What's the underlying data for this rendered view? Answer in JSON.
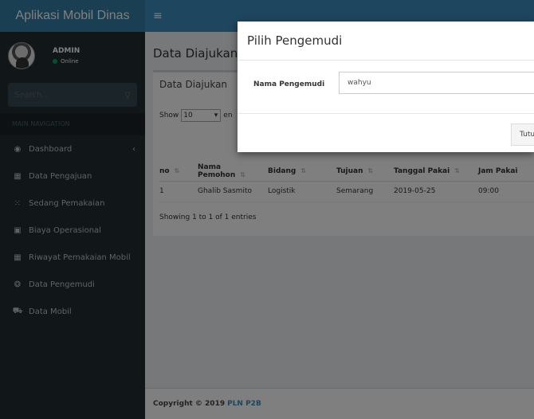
{
  "app": {
    "title": "Aplikasi Mobil Dinas"
  },
  "user": {
    "name": "ADMIN",
    "status": "Online"
  },
  "search": {
    "placeholder": "Search..."
  },
  "nav": {
    "header": "MAIN NAVIGATION",
    "items": [
      {
        "label": "Dashboard",
        "icon": "dashboard-icon"
      },
      {
        "label": "Data Pengajuan",
        "icon": "table-icon"
      },
      {
        "label": "Sedang Pemakaian",
        "icon": "spinner-icon"
      },
      {
        "label": "Biaya Operasional",
        "icon": "money-icon"
      },
      {
        "label": "Riwayat Pemakaian Mobil",
        "icon": "calendar-icon"
      },
      {
        "label": "Data Pengemudi",
        "icon": "steering-icon"
      },
      {
        "label": "Data Mobil",
        "icon": "car-icon"
      }
    ]
  },
  "page": {
    "title": "Data Diajukan",
    "box_title": "Data Diajukan",
    "show_prefix": "Show",
    "show_value": "10",
    "show_suffix": "en",
    "table": {
      "headers": [
        "no",
        "Nama Pemohon",
        "Bidang",
        "Tujuan",
        "Tanggal Pakai",
        "Jam Pakai"
      ],
      "rows": [
        [
          "1",
          "Ghalib Sasmito",
          "Logistik",
          "Semarang",
          "2019-05-25",
          "09:00"
        ]
      ]
    },
    "entries_info": "Showing 1 to 1 of 1 entries"
  },
  "footer": {
    "copyright": "Copyright © 2019",
    "link": "PLN P2B"
  },
  "modal": {
    "title": "Pilih Pengemudi",
    "field_label": "Nama Pengemudi",
    "field_value": "wahyu",
    "close_label": "Tutup"
  },
  "colors": {
    "sidebar": "#222d32",
    "header": "#3c8dbc",
    "logo": "#357ca5",
    "online": "#00a65a"
  }
}
